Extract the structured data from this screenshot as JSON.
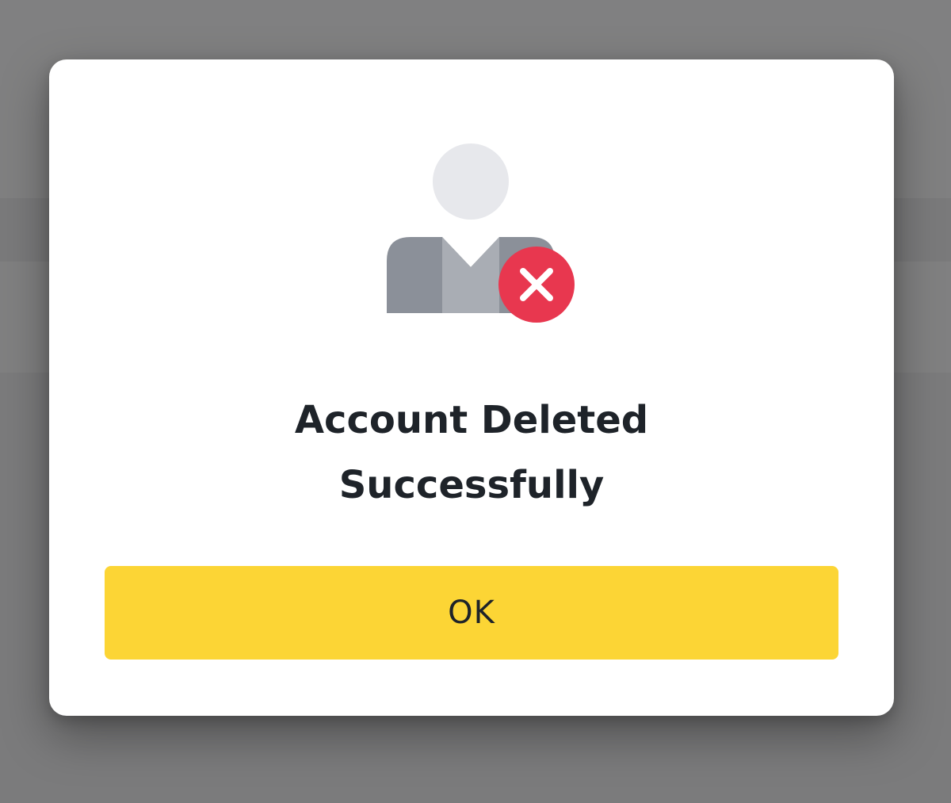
{
  "dialog": {
    "title_line1": "Account Deleted",
    "title_line2": "Successfully",
    "ok_label": "OK",
    "illustration_icon": "deleted-user-icon",
    "status_icon": "close-icon"
  },
  "colors": {
    "backdrop": "#7e7e7f",
    "dialog_background": "#ffffff",
    "title_text": "#1e2329",
    "button_background": "#fcd535",
    "button_text": "#1e2329",
    "error_badge": "#e8374f",
    "avatar_head": "#e7e8ec",
    "avatar_shoulder_dark": "#8b9099",
    "avatar_shoulder_light": "#a9adb4"
  }
}
